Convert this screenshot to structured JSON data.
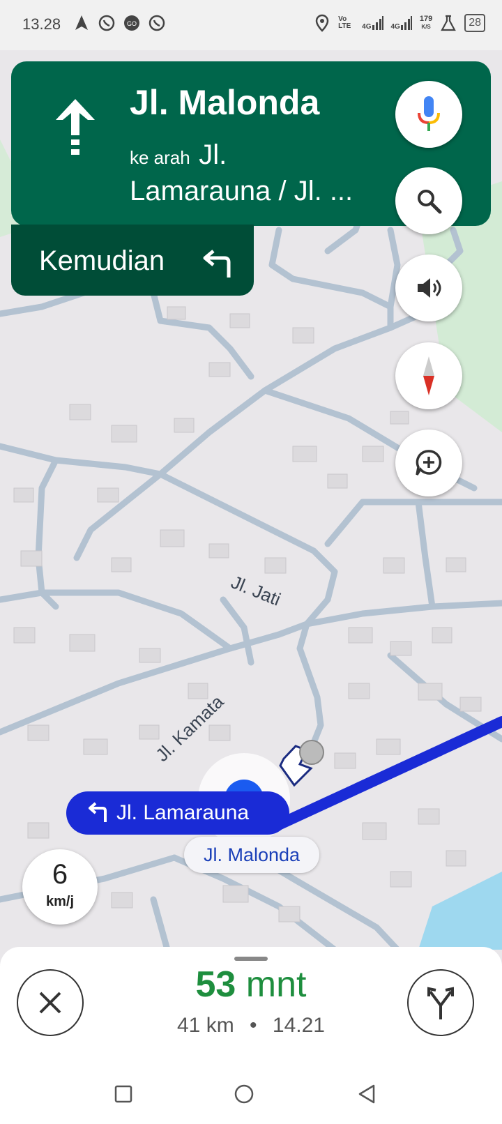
{
  "status_bar": {
    "time": "13.28",
    "network_1": "Vo LTE",
    "network_2": "4G",
    "network_3": "4G",
    "speed_value": "179",
    "speed_unit": "K/S",
    "battery": "28",
    "left_icons": [
      "navigation-icon",
      "whatsapp-icon",
      "gojek-icon",
      "whatsapp-icon"
    ],
    "right_icons": [
      "location-icon",
      "signal-icon",
      "signal-icon",
      "lab-icon",
      "battery-icon"
    ]
  },
  "navigation": {
    "current_street": "Jl. Malonda",
    "toward_prefix": "ke arah",
    "toward_street_line1": "Jl.",
    "toward_street_line2": "Lamarauna / Jl. ...",
    "then_label": "Kemudian",
    "maneuver_icon": "straight-arrow-icon",
    "then_icon": "turn-left-icon"
  },
  "map": {
    "street_labels": [
      "Jl. Jati",
      "Jl. Kamata"
    ],
    "route_color": "#1a2bd6",
    "next_turn_label": "Jl. Lamarauna",
    "current_street_label": "Jl. Malonda"
  },
  "fab_buttons": [
    "microphone-icon",
    "search-icon",
    "volume-icon",
    "compass-icon",
    "add-comment-icon"
  ],
  "speedometer": {
    "value": "6",
    "unit": "km/j"
  },
  "trip": {
    "eta_number": "53",
    "eta_unit": "mnt",
    "distance": "41 km",
    "separator": "•",
    "arrival_time": "14.21",
    "eta_color": "#1e8e3e"
  },
  "colors": {
    "banner": "#00664b",
    "banner_dark": "#004d37"
  }
}
